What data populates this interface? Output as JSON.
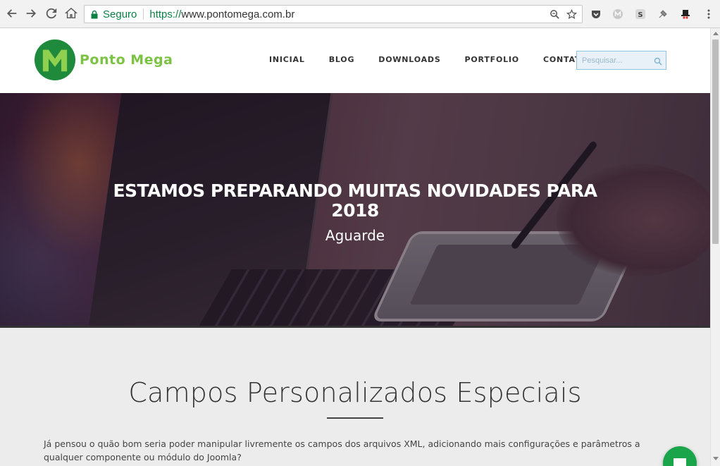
{
  "browser": {
    "secure_label": "Seguro",
    "url_scheme": "https://",
    "url_host": "www.pontomega.com.br"
  },
  "site": {
    "logo_text": "Ponto Mega",
    "nav": [
      "INICIAL",
      "BLOG",
      "DOWNLOADS",
      "PORTFOLIO",
      "CONTATO"
    ],
    "search_placeholder": "Pesquisar..."
  },
  "hero": {
    "title_line1": "ESTAMOS PREPARANDO MUITAS NOVIDADES PARA",
    "title_line2": "2018",
    "subtitle": "Aguarde"
  },
  "section": {
    "title": "Campos Personalizados Especiais",
    "intro": "Já pensou o quão bom seria poder manipular livremente os campos dos arquivos XML, adicionando mais configurações e parâmetros a qualquer componente ou módulo do Joomla?"
  },
  "colors": {
    "brand_green": "#1f8a3c",
    "logo_text_green": "#7cc243",
    "chat_green": "#1aa54a",
    "secure_green": "#0b8043"
  }
}
